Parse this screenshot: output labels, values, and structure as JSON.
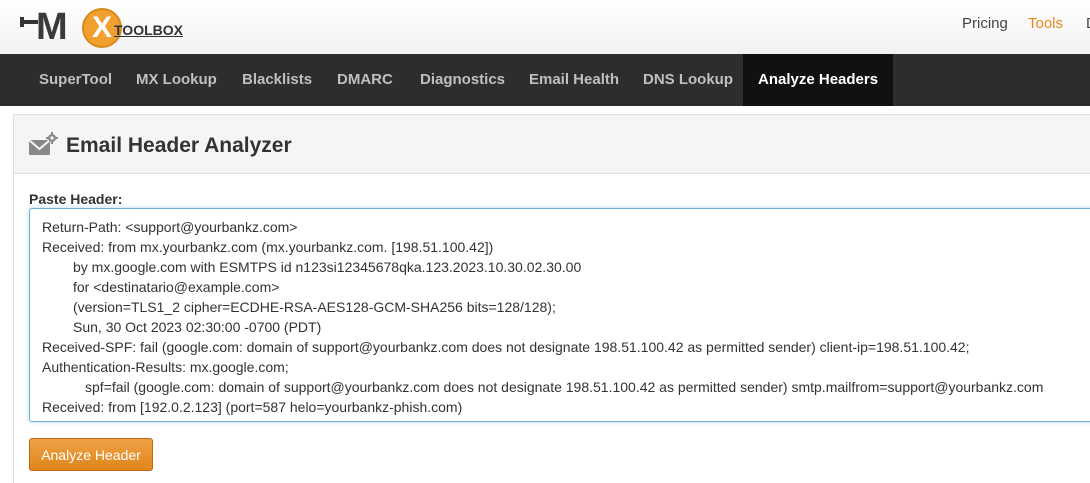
{
  "logo": {
    "text": "TOOLBOX",
    "letter_m": "M",
    "letter_x": "X"
  },
  "top_links": {
    "pricing": "Pricing",
    "tools": "Tools",
    "clipped": "D"
  },
  "nav": {
    "items": [
      {
        "label": "SuperTool"
      },
      {
        "label": "MX Lookup"
      },
      {
        "label": "Blacklists"
      },
      {
        "label": "DMARC"
      },
      {
        "label": "Diagnostics"
      },
      {
        "label": "Email Health"
      },
      {
        "label": "DNS Lookup"
      },
      {
        "label": "Analyze Headers"
      }
    ],
    "active": "Analyze Headers"
  },
  "panel": {
    "title": "Email Header Analyzer",
    "icon": "envelope-gear-icon"
  },
  "form": {
    "paste_label": "Paste Header:",
    "lines": [
      "Return-Path: <support@yourbankz.com>",
      "Received: from mx.yourbankz.com (mx.yourbankz.com. [198.51.100.42])",
      "by mx.google.com with ESMTPS id n123si12345678qka.123.2023.10.30.02.30.00",
      "for <destinatario@example.com>",
      "(version=TLS1_2 cipher=ECDHE-RSA-AES128-GCM-SHA256 bits=128/128);",
      "Sun, 30 Oct 2023 02:30:00 -0700 (PDT)",
      "Received-SPF: fail (google.com: domain of support@yourbankz.com does not designate 198.51.100.42 as permitted sender) client-ip=198.51.100.42;",
      "Authentication-Results: mx.google.com;",
      "spf=fail (google.com: domain of support@yourbankz.com does not designate 198.51.100.42 as permitted sender) smtp.mailfrom=support@yourbankz.com",
      "Received: from [192.0.2.123] (port=587 helo=yourbankz-phish.com)"
    ],
    "button_label": "Analyze Header"
  },
  "colors": {
    "accent": "#e8891d",
    "nav_bg": "#2d2d2d",
    "nav_active_bg": "#111111",
    "focus_border": "#6fb0d8"
  }
}
